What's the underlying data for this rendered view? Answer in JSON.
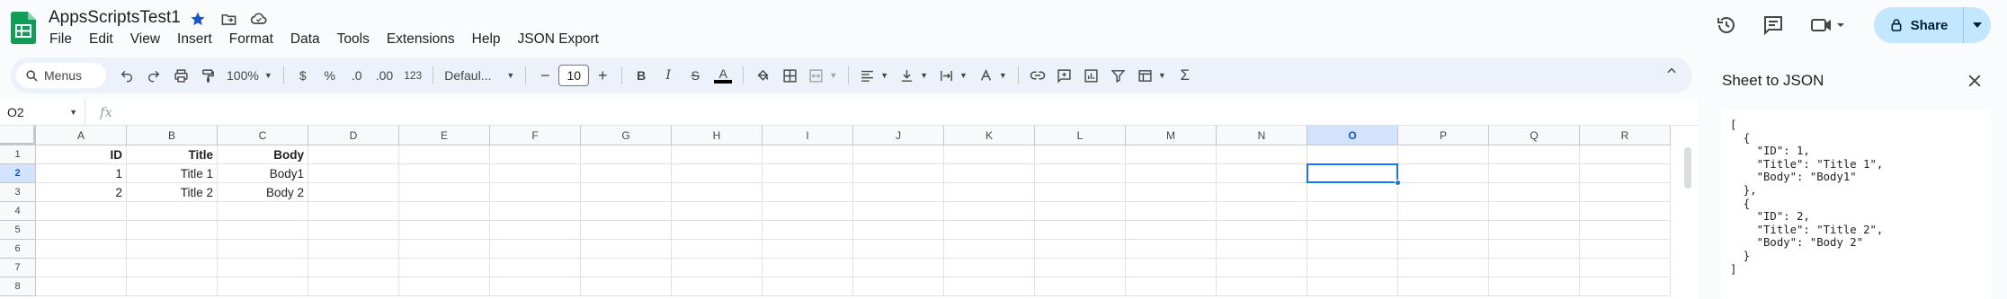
{
  "doc": {
    "title": "AppsScriptsTest1"
  },
  "menu": [
    "File",
    "Edit",
    "View",
    "Insert",
    "Format",
    "Data",
    "Tools",
    "Extensions",
    "Help",
    "JSON Export"
  ],
  "share": {
    "label": "Share"
  },
  "toolbar": {
    "search_label": "Menus",
    "zoom": "100%",
    "currency": "$",
    "percent": "%",
    "dec_decrease": ".0",
    "dec_increase": ".00",
    "number_format": "123",
    "font": "Defaul...",
    "font_size": "10",
    "bold": "B",
    "italic": "I",
    "strike": "S",
    "text_color": "A",
    "sigma": "Σ"
  },
  "formula_bar": {
    "cell_ref": "O2",
    "fx": "fx",
    "value": ""
  },
  "columns": [
    "A",
    "B",
    "C",
    "D",
    "E",
    "F",
    "G",
    "H",
    "I",
    "J",
    "K",
    "L",
    "M",
    "N",
    "O",
    "P",
    "Q",
    "R"
  ],
  "selected_column": "O",
  "rows": [
    "1",
    "2",
    "3",
    "4",
    "5",
    "6",
    "7",
    "8"
  ],
  "selected_row": "2",
  "cells": {
    "A1": "ID",
    "B1": "Title",
    "C1": "Body",
    "A2": "1",
    "B2": "Title 1",
    "C2": "Body1",
    "A3": "2",
    "B3": "Title 2",
    "C3": "Body 2"
  },
  "panel": {
    "title": "Sheet to JSON",
    "json": "[\n  {\n    \"ID\": 1,\n    \"Title\": \"Title 1\",\n    \"Body\": \"Body1\"\n  },\n  {\n    \"ID\": 2,\n    \"Title\": \"Title 2\",\n    \"Body\": \"Body 2\"\n  }\n]"
  },
  "colors": {
    "accent": "#1a73e8",
    "share_bg": "#c2e7ff",
    "sheets_green": "#0f9d58",
    "star": "#1a56c4"
  }
}
